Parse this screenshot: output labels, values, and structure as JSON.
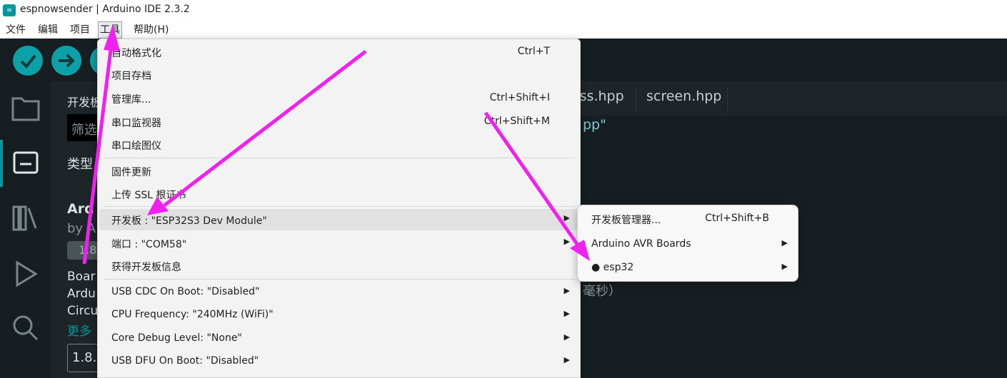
{
  "window": {
    "title": "espnowsender | Arduino IDE 2.3.2",
    "app_icon": "arduino-infinity-icon"
  },
  "menubar": [
    {
      "label": "文件"
    },
    {
      "label": "编辑"
    },
    {
      "label": "项目"
    },
    {
      "label": "工具"
    },
    {
      "label": "帮助(H)"
    }
  ],
  "toolbar": {
    "verify_icon": "check-icon",
    "upload_icon": "arrow-right-icon",
    "debug_icon": "debug-icon"
  },
  "sidebar": {
    "icons": [
      "folder-icon",
      "board-manager-icon",
      "library-icon",
      "debug-icon",
      "search-icon"
    ]
  },
  "panel": {
    "title": "开发板",
    "filter_placeholder": "筛选",
    "type_label": "类型",
    "item_title": "Ard",
    "item_by": "by A",
    "version_badge": "1.8",
    "desc1": "Boar",
    "desc2": "Ardu",
    "desc3": "Circu",
    "more": "更多",
    "version_select": "1.8."
  },
  "editor": {
    "tabs": [
      {
        "label": "ass.hpp"
      },
      {
        "label": "screen.hpp"
      }
    ],
    "code_fragment": "pp\"",
    "comment_fragment": "毫秒）"
  },
  "tools_menu": {
    "items": [
      {
        "label": "自动格式化",
        "shortcut": "Ctrl+T"
      },
      {
        "label": "项目存档",
        "shortcut": ""
      },
      {
        "label": "管理库...",
        "shortcut": "Ctrl+Shift+I"
      },
      {
        "label": "串口监视器",
        "shortcut": "Ctrl+Shift+M"
      },
      {
        "label": "串口绘图仪",
        "shortcut": ""
      },
      {
        "label": "固件更新",
        "shortcut": ""
      },
      {
        "label": "上传 SSL 根证书",
        "shortcut": ""
      },
      {
        "label": "开发板 : \"ESP32S3 Dev Module\"",
        "shortcut": "",
        "submenu": true
      },
      {
        "label": "端口 : \"COM58\"",
        "shortcut": "",
        "submenu": true
      },
      {
        "label": "获得开发板信息",
        "shortcut": ""
      },
      {
        "label": "USB CDC On Boot: \"Disabled\"",
        "shortcut": "",
        "submenu": true
      },
      {
        "label": "CPU Frequency: \"240MHz (WiFi)\"",
        "shortcut": "",
        "submenu": true
      },
      {
        "label": "Core Debug Level: \"None\"",
        "shortcut": "",
        "submenu": true
      },
      {
        "label": "USB DFU On Boot: \"Disabled\"",
        "shortcut": "",
        "submenu": true
      }
    ]
  },
  "board_submenu": {
    "items": [
      {
        "label": "开发板管理器...",
        "shortcut": "Ctrl+Shift+B"
      },
      {
        "label": "Arduino AVR Boards",
        "submenu": true
      },
      {
        "label": "● esp32",
        "submenu": true
      }
    ]
  },
  "annotation_color": "#f020f0"
}
